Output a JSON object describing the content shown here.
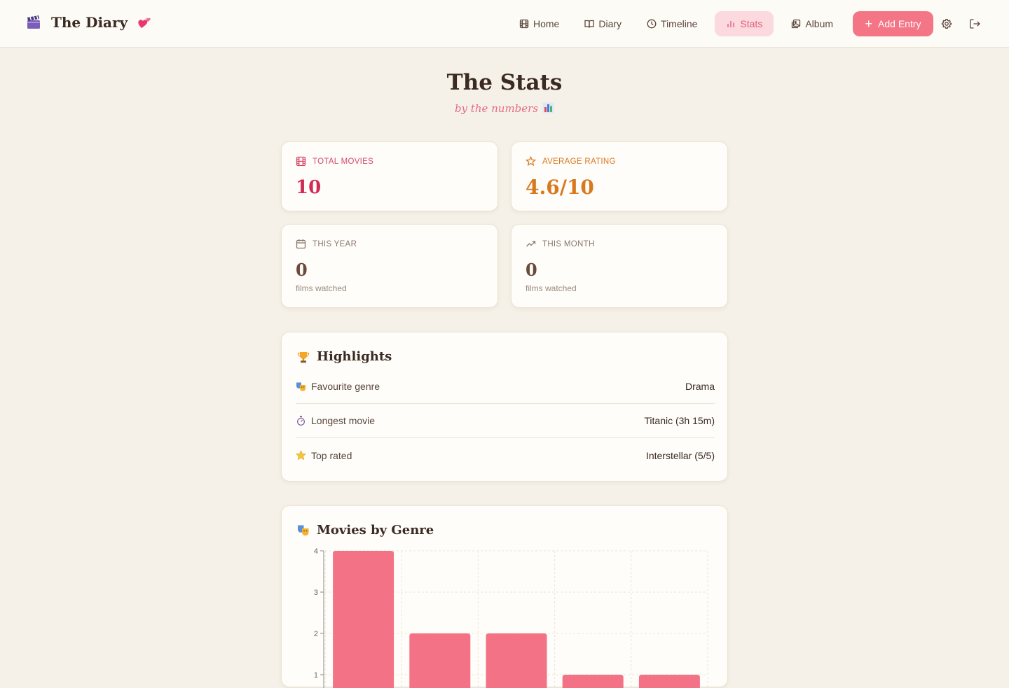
{
  "header": {
    "brand_title": "The Diary",
    "nav": [
      {
        "label": "Home",
        "icon": "film-icon",
        "active": false
      },
      {
        "label": "Diary",
        "icon": "book-icon",
        "active": false
      },
      {
        "label": "Timeline",
        "icon": "clock-icon",
        "active": false
      },
      {
        "label": "Stats",
        "icon": "bar-chart-icon",
        "active": true
      },
      {
        "label": "Album",
        "icon": "album-icon",
        "active": false
      }
    ],
    "add_entry_label": "Add Entry"
  },
  "page": {
    "title": "The Stats",
    "subtitle": "by the numbers"
  },
  "stats": {
    "total_movies": {
      "label": "TOTAL MOVIES",
      "value": "10"
    },
    "average_rating": {
      "label": "AVERAGE RATING",
      "value": "4.6/10"
    },
    "this_year": {
      "label": "THIS YEAR",
      "value": "0",
      "sub": "films watched"
    },
    "this_month": {
      "label": "THIS MONTH",
      "value": "0",
      "sub": "films watched"
    }
  },
  "highlights": {
    "title": "Highlights",
    "rows": [
      {
        "label": "Favourite genre",
        "value": "Drama"
      },
      {
        "label": "Longest movie",
        "value": "Titanic (3h 15m)"
      },
      {
        "label": "Top rated",
        "value": "Interstellar (5/5)"
      }
    ]
  },
  "genre_chart": {
    "title": "Movies by Genre"
  },
  "colors": {
    "accent": "#f47585",
    "rating": "#d9791f",
    "total": "#d32a55",
    "stat_value": "#6b4a3a",
    "bar": "#f47285",
    "background": "#f6f1e8"
  },
  "chart_data": {
    "type": "bar",
    "title": "Movies by Genre",
    "categories": [
      "",
      "",
      "",
      "",
      ""
    ],
    "values": [
      4,
      2,
      2,
      1,
      1
    ],
    "yticks": [
      "1",
      "2",
      "3",
      "4"
    ],
    "ylim": [
      0,
      4
    ],
    "grid": true,
    "xlabel": "",
    "ylabel": ""
  }
}
